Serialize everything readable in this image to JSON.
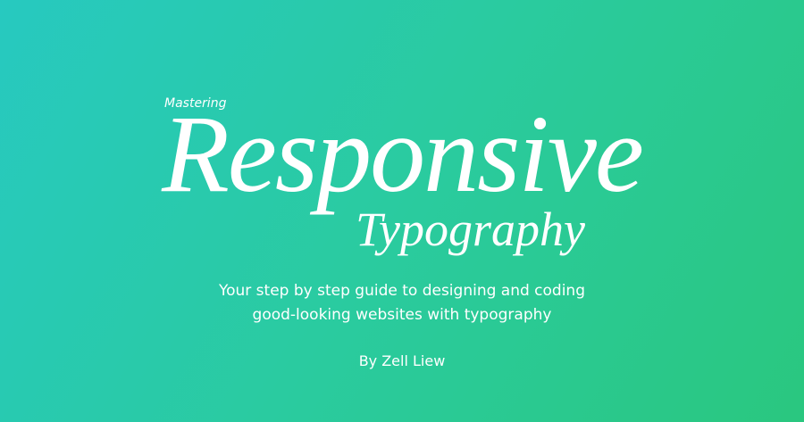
{
  "hero": {
    "eyebrow": "Mastering",
    "title": "Responsive",
    "subtitle": "Typography",
    "tagline": {
      "line1": "Your step by step guide to designing and coding",
      "line2": "good-looking websites with typography"
    },
    "byline": "By Zell Liew"
  },
  "colors": {
    "gradient_start": "#27c9c0",
    "gradient_end": "#2ac77f",
    "text": "#ffffff"
  }
}
